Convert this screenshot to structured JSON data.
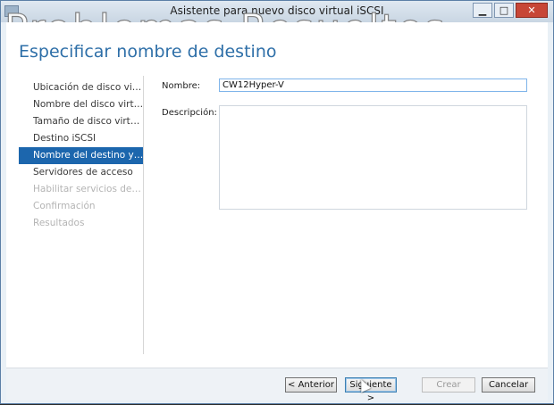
{
  "window": {
    "title": "Asistente para nuevo disco virtual iSCSI",
    "minimize": "▁",
    "maximize": "□",
    "close": "✕"
  },
  "watermark": "Problemas Resueltos",
  "page_title": "Especificar nombre de destino",
  "nav": {
    "items": [
      {
        "label": "Ubicación de disco virtual...",
        "state": "normal"
      },
      {
        "label": "Nombre del disco virtual i...",
        "state": "normal"
      },
      {
        "label": "Tamaño de disco virtual i...",
        "state": "normal"
      },
      {
        "label": "Destino iSCSI",
        "state": "normal"
      },
      {
        "label": "Nombre del destino y acc...",
        "state": "active"
      },
      {
        "label": "Servidores de acceso",
        "state": "normal"
      },
      {
        "label": "Habilitar servicios de aute...",
        "state": "disabled"
      },
      {
        "label": "Confirmación",
        "state": "disabled"
      },
      {
        "label": "Resultados",
        "state": "disabled"
      }
    ]
  },
  "form": {
    "name_label": "Nombre:",
    "name_value": "CW12Hyper-V",
    "description_label": "Descripción:",
    "description_value": ""
  },
  "footer": {
    "previous": "< Anterior",
    "next": "Siguiente >",
    "create": "Crear",
    "cancel": "Cancelar"
  }
}
